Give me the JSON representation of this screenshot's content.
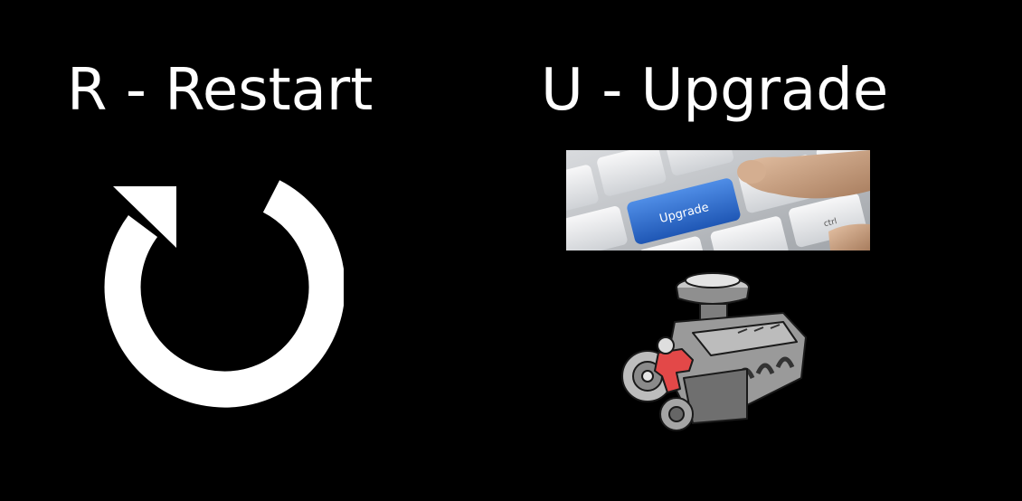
{
  "restart": {
    "label": "R - Restart",
    "icon": "restart-icon"
  },
  "upgrade": {
    "label": "U - Upgrade",
    "key_label": "Upgrade",
    "ctrl_label": "ctrl"
  },
  "colors": {
    "background": "#000000",
    "text": "#ffffff",
    "upgrade_key": "#2f6fd0",
    "engine_highlight": "#e34848"
  }
}
